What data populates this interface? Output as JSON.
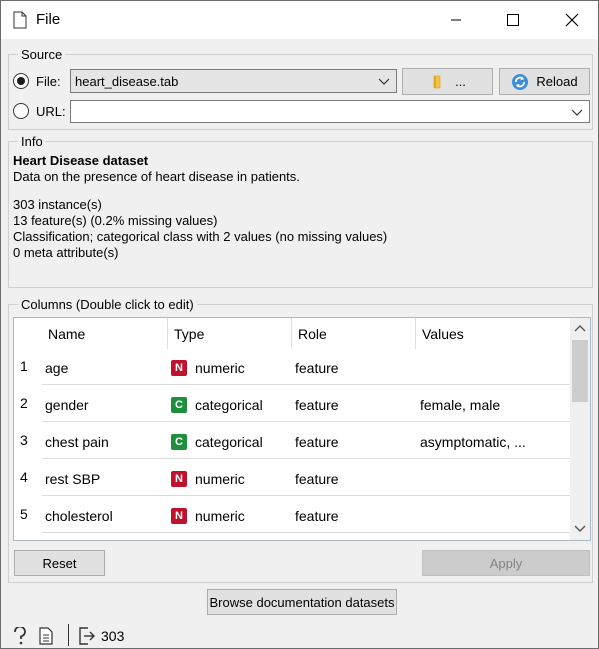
{
  "window": {
    "title": "File"
  },
  "source": {
    "group_title": "Source",
    "file_label": "File:",
    "file_value": "heart_disease.tab",
    "browse_label": "...",
    "reload_label": "Reload",
    "url_label": "URL:",
    "url_value": ""
  },
  "info": {
    "group_title": "Info",
    "dataset_title": "Heart Disease dataset",
    "description": "Data on the presence of heart disease in patients.",
    "lines": [
      "303 instance(s)",
      "13 feature(s) (0.2% missing values)",
      "Classification; categorical class with 2 values (no missing values)",
      "0 meta attribute(s)"
    ]
  },
  "columns": {
    "group_title": "Columns (Double click to edit)",
    "headers": [
      "Name",
      "Type",
      "Role",
      "Values"
    ],
    "rows": [
      {
        "num": "1",
        "name": "age",
        "badge": "N",
        "type": "numeric",
        "role": "feature",
        "values": ""
      },
      {
        "num": "2",
        "name": "gender",
        "badge": "C",
        "type": "categorical",
        "role": "feature",
        "values": "female, male"
      },
      {
        "num": "3",
        "name": "chest pain",
        "badge": "C",
        "type": "categorical",
        "role": "feature",
        "values": "asymptomatic, ..."
      },
      {
        "num": "4",
        "name": "rest SBP",
        "badge": "N",
        "type": "numeric",
        "role": "feature",
        "values": ""
      },
      {
        "num": "5",
        "name": "cholesterol",
        "badge": "N",
        "type": "numeric",
        "role": "feature",
        "values": ""
      }
    ],
    "reset_label": "Reset",
    "apply_label": "Apply"
  },
  "browse_docs_label": "Browse documentation datasets",
  "status": {
    "output_count": "303"
  },
  "colors": {
    "numeric_badge": "#c0122a",
    "categorical_badge": "#1e8f3a"
  },
  "icons": [
    "document-icon",
    "minimize-icon",
    "maximize-icon",
    "close-icon",
    "folder-icon",
    "reload-icon",
    "chevron-down-icon",
    "help-icon",
    "report-icon",
    "output-icon"
  ]
}
